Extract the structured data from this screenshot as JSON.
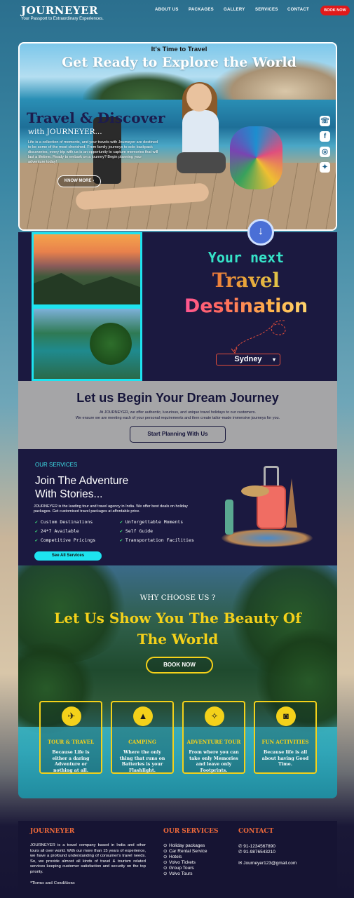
{
  "header": {
    "brand": "JOURNEYER",
    "tagline": "Your Passport to Extraordinary Experiences.",
    "nav": [
      "ABOUT US",
      "PACKAGES",
      "GALLERY",
      "SERVICES",
      "CONTACT"
    ],
    "book_label": "BOOK NOW",
    "colors": {
      "accent": "#e01a1a"
    }
  },
  "hero": {
    "pretitle": "It's Time to Travel",
    "title": "Get Ready to Explore the World",
    "heading": "Travel & Discover",
    "subheading": "with JOURNEYER...",
    "description": "Life is a collection of moments, and your travels with Journeyer are destined to be some of the most cherished. From family journeys to solo backpack discoveries, every trip with us is an opportunity to capture memories that will last a lifetime. Ready to embark on a journey? Begin planning your adventure today!",
    "know_more": "KNOW MORE",
    "social_icons": [
      "whatsapp-icon",
      "facebook-icon",
      "instagram-icon",
      "twitter-icon"
    ]
  },
  "destination": {
    "line1": "Your next",
    "line2": "Travel",
    "line3": "Destination",
    "selected": "Sydney"
  },
  "dream": {
    "title": "Let us Begin Your Dream Journey",
    "line1": "At JOURNEYER, we offer authentic, luxurious, and unique travel holidays to our customers.",
    "line2": "We ensure we are meeting each of your personal requirements and then create tailor-made immersive journeys for you.",
    "cta": "Start Planning With Us"
  },
  "services": {
    "eyebrow": "OUR SERVICES",
    "title_line1": "Join The Adventure",
    "title_line2": "With Stories...",
    "description": "JOURNEYER is the leading tour and travel agency in India. We offer best deals on holiday packages. Get customised travel packages at affordable price.",
    "features": [
      "Custom Destinations",
      "Unforgettable Moments",
      "24*7 Available",
      "Self Guide",
      "Competitive Pricings",
      "Transportation Facilities"
    ],
    "see_all": "See All Services"
  },
  "why": {
    "eyebrow": "WHY CHOOSE US ?",
    "title_line1": "Let Us Show You The Beauty Of",
    "title_line2": "The World",
    "book": "BOOK NOW",
    "cards": [
      {
        "icon": "plane-icon",
        "title": "TOUR & TRAVEL",
        "desc": "Because Life is either a daring Adventure or nothing at all."
      },
      {
        "icon": "tent-icon",
        "title": "CAMPING",
        "desc": "Where the only thing that runs on Batteries is your Flashlight."
      },
      {
        "icon": "compass-icon",
        "title": "ADVENTURE TOUR",
        "desc": "From where you can take only Memories and leave only Footprints."
      },
      {
        "icon": "camera-icon",
        "title": "FUN ACTIVITIES",
        "desc": "Because life is all about having Good Time."
      }
    ],
    "colors": {
      "accent": "#f4d11a"
    }
  },
  "footer": {
    "brand": "JOURNEYER",
    "about": "JOURNEYER is a travel company based in India and other tours all over world. With our more than 15 years of experience, we have a profound understanding of consumer's travel needs. So, we provide almost all kinds of travel & tourism related services keeping customer satisfaction and security on the top priority.",
    "terms": "*Terms and Conditions",
    "services_heading": "OUR SERVICES",
    "services": [
      "Holiday packages",
      "Car Rental Service",
      "Hotels",
      "Volvo Tickets",
      "Group Tours",
      "Volvo Tours"
    ],
    "contact_heading": "CONTACT",
    "phone1": "91-1234567890",
    "phone2": "91-9876543210",
    "email": "Journeyer123@gmail.com",
    "colors": {
      "heading": "#f06a3a"
    }
  }
}
